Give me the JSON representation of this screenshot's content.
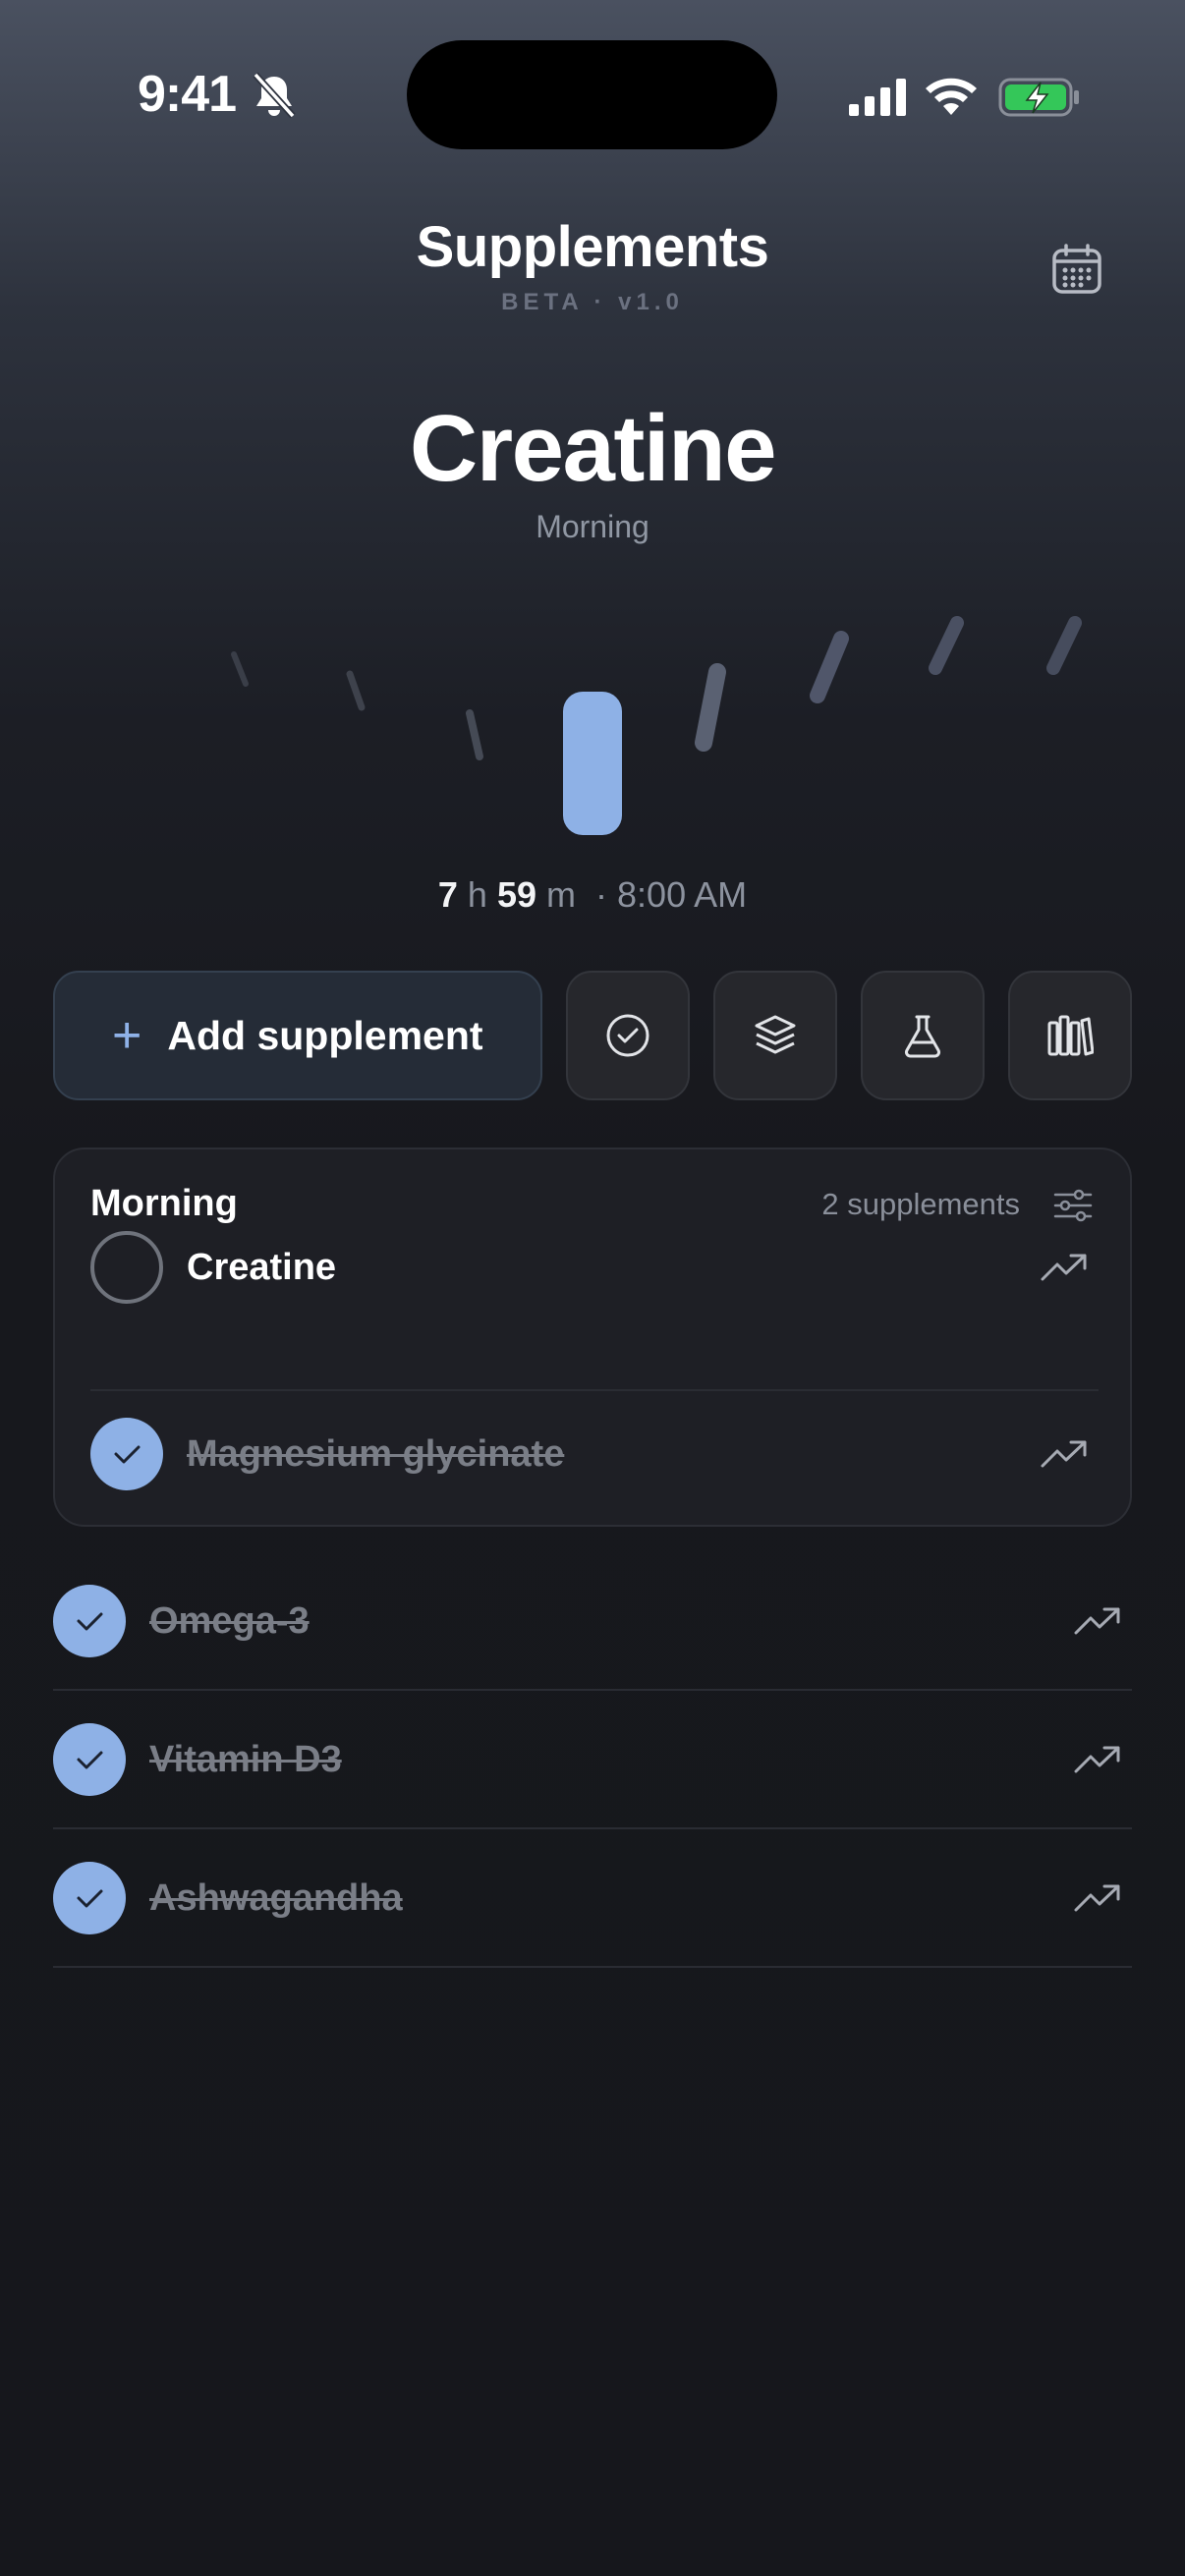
{
  "status_bar": {
    "time": "9:41"
  },
  "header": {
    "title": "Supplements",
    "version": "BETA · v1.0"
  },
  "hero": {
    "name": "Creatine",
    "slot": "Morning",
    "countdown_hours": "7",
    "hours_unit": "h",
    "countdown_minutes": "59",
    "minutes_unit": "m",
    "scheduled_time": "· 8:00 AM"
  },
  "actions": {
    "add_label": "Add supplement",
    "icons": [
      "check-circle-icon",
      "layers-icon",
      "flask-icon",
      "library-icon"
    ]
  },
  "morning_group": {
    "title": "Morning",
    "count": "2 supplements",
    "items": [
      {
        "name": "Creatine",
        "done": false
      },
      {
        "name": "Magnesium glycinate",
        "done": true
      }
    ]
  },
  "other_items": [
    {
      "name": "Omega-3",
      "done": true
    },
    {
      "name": "Vitamin D3",
      "done": true
    },
    {
      "name": "Ashwagandha",
      "done": true
    }
  ],
  "colors": {
    "accent": "#8eb1e6",
    "background": "#16171c",
    "card": "#1e1f25",
    "muted_text": "#7a7e87"
  }
}
